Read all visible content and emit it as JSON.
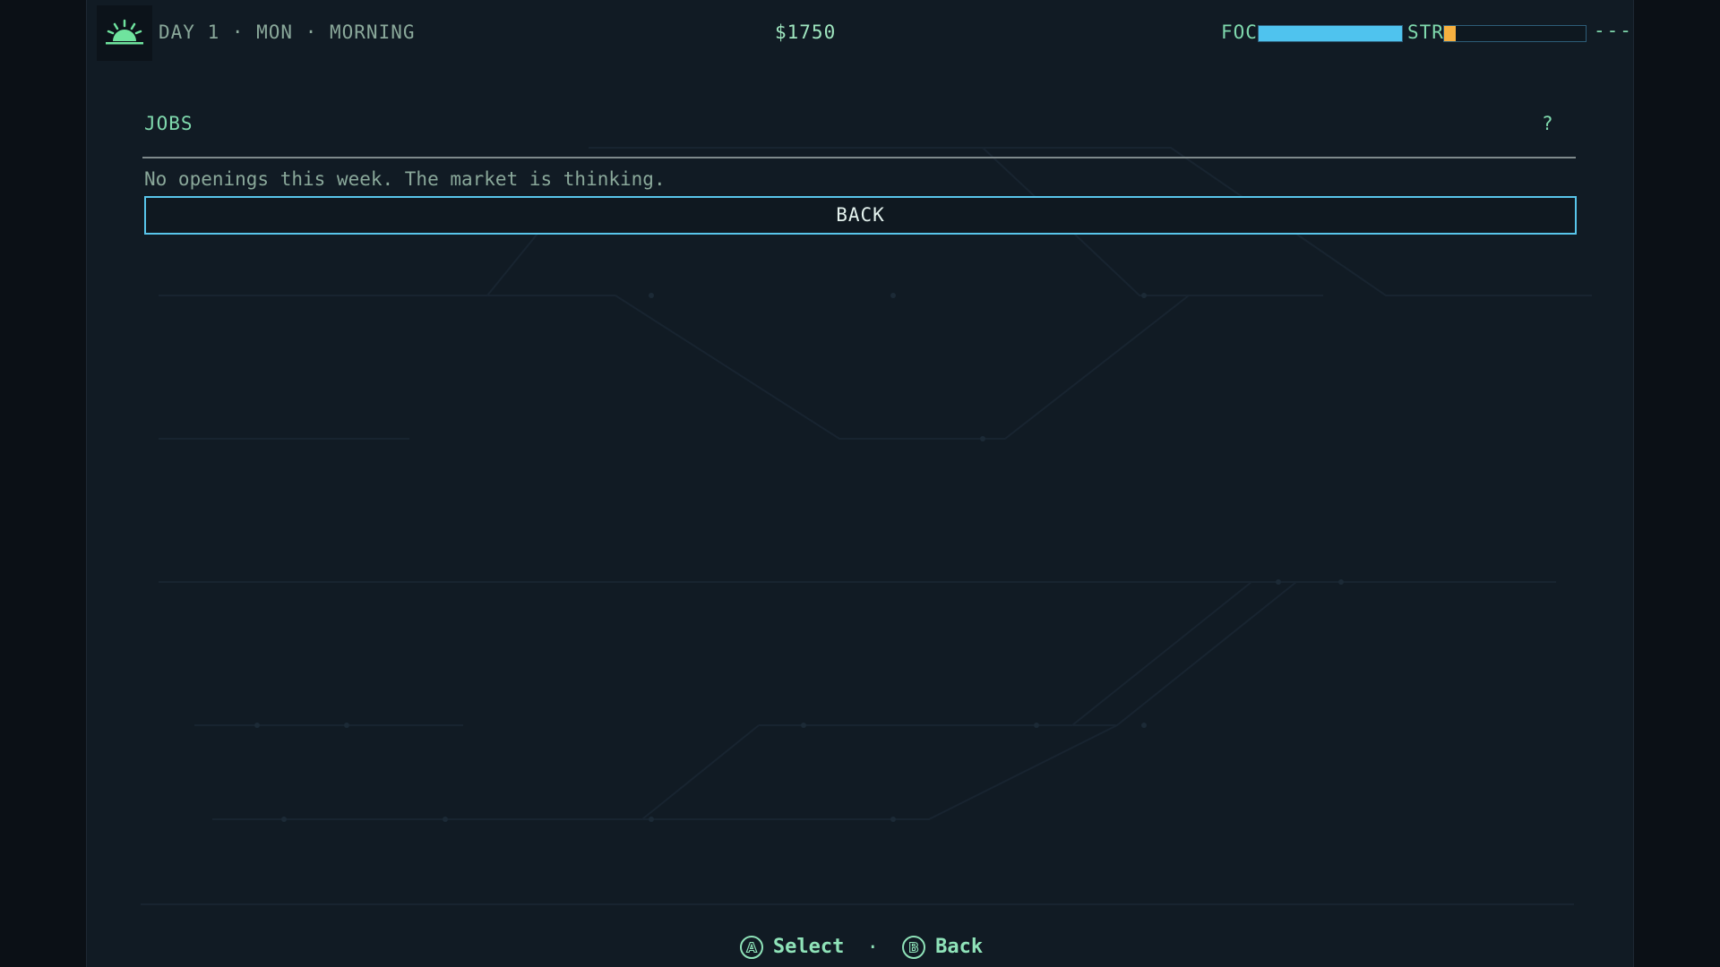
{
  "hud": {
    "time_of_day_icon": "sunrise-icon",
    "day_text": "DAY 1 · MON · MORNING",
    "money": "$1750",
    "focus_label": "FOC",
    "focus_level": 1.0,
    "stress_label": "STR",
    "stress_level": 0.08,
    "trailing_text": "---",
    "colors": {
      "accent_green": "#7fd9ad",
      "focus_bar": "#4fc3ee",
      "stress_bar": "#f6b040"
    }
  },
  "panel": {
    "title": "JOBS",
    "help_label": "?",
    "empty_message": "No openings this week. The market is thinking.",
    "back_label": "BACK"
  },
  "footer": {
    "select_glyph": "A",
    "select_label": "Select",
    "separator": "·",
    "back_glyph": "B",
    "back_label": "Back"
  }
}
